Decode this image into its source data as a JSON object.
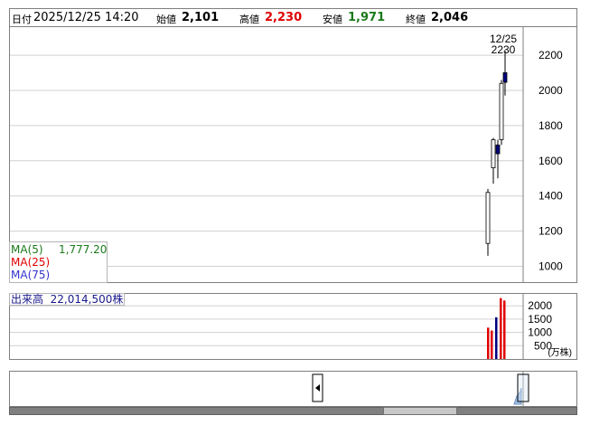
{
  "header": {
    "date_label": "日付",
    "date_value": "2025/12/25 14:20",
    "open_label": "始値",
    "open_value": "2,101",
    "high_label": "高値",
    "high_value": "2,230",
    "low_label": "安値",
    "low_value": "1,971",
    "close_label": "終値",
    "close_value": "2,046"
  },
  "legend": {
    "ma5_label": "MA(5)",
    "ma5_value": "1,777.20",
    "ma25_label": "MA(25)",
    "ma75_label": "MA(75)",
    "volume_label": "出来高",
    "volume_value": "22,014,500株"
  },
  "annotation": {
    "date": "12/25",
    "price": "2230"
  },
  "volume_unit": "(万株)",
  "colors": {
    "up": "#ffffff",
    "down": "#000080",
    "volume_up": "#e00000",
    "volume_down": "#000080",
    "ma5": "#1a7a1a",
    "ma25": "#e00000",
    "ma75": "#3333cc",
    "grid": "#d0d0d0"
  },
  "chart_data": [
    {
      "type": "candlestick",
      "ylim": [
        910,
        2360
      ],
      "yticks": [
        "1000",
        "1200",
        "1400",
        "1600",
        "1800",
        "2000",
        "2200"
      ],
      "grid": true,
      "series": [
        {
          "name": "price",
          "candles": [
            {
              "open": 1130,
              "high": 1440,
              "low": 1060,
              "close": 1420,
              "direction": "up"
            },
            {
              "open": 1560,
              "high": 1730,
              "low": 1470,
              "close": 1720,
              "direction": "up"
            },
            {
              "open": 1690,
              "high": 1720,
              "low": 1500,
              "close": 1640,
              "direction": "down"
            },
            {
              "open": 1720,
              "high": 2060,
              "low": 1690,
              "close": 2040,
              "direction": "up"
            },
            {
              "open": 2101,
              "high": 2230,
              "low": 1971,
              "close": 2046,
              "direction": "down"
            }
          ]
        }
      ]
    },
    {
      "type": "bar",
      "ylim": [
        0,
        2450
      ],
      "yticks": [
        "500",
        "1000",
        "1500",
        "2000"
      ],
      "series": [
        {
          "name": "出来高",
          "values": [
            {
              "value": 1180,
              "direction": "up"
            },
            {
              "value": 1070,
              "direction": "up"
            },
            {
              "value": 1570,
              "direction": "down"
            },
            {
              "value": 2290,
              "direction": "up"
            },
            {
              "value": 2200,
              "direction": "up"
            }
          ]
        }
      ]
    }
  ]
}
